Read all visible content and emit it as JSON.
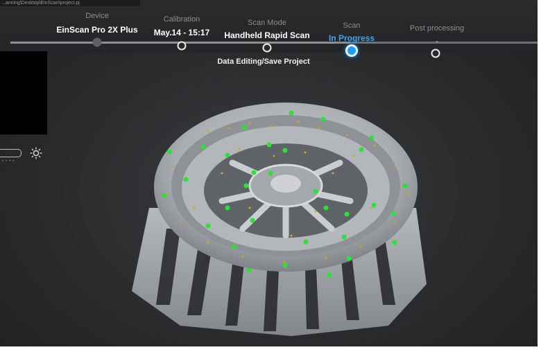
{
  "window": {
    "path_text": "...anning\\Desktop\\EinScan\\project.pj"
  },
  "steps": [
    {
      "label": "Device",
      "value": "EinScan Pro 2X Plus",
      "state": "done"
    },
    {
      "label": "Calibration",
      "value": "May.14 - 15:17",
      "state": "done"
    },
    {
      "label": "Scan Mode",
      "value": "Handheld Rapid Scan",
      "state": "done"
    },
    {
      "label": "Scan",
      "value": "In Progress",
      "state": "active"
    },
    {
      "label": "Post processing",
      "value": "-",
      "state": "pending"
    }
  ],
  "sub_status": "Data Editing/Save Project",
  "side": {
    "brightness_icon": "sun-icon"
  },
  "colors": {
    "accent": "#1f9cff",
    "marker_points": "#2ee03a",
    "noise_points": "#d6a040",
    "scan_surface": "#b9bcc0"
  },
  "viewport": {
    "model": "scanned-wheel-rim-point-cloud"
  }
}
